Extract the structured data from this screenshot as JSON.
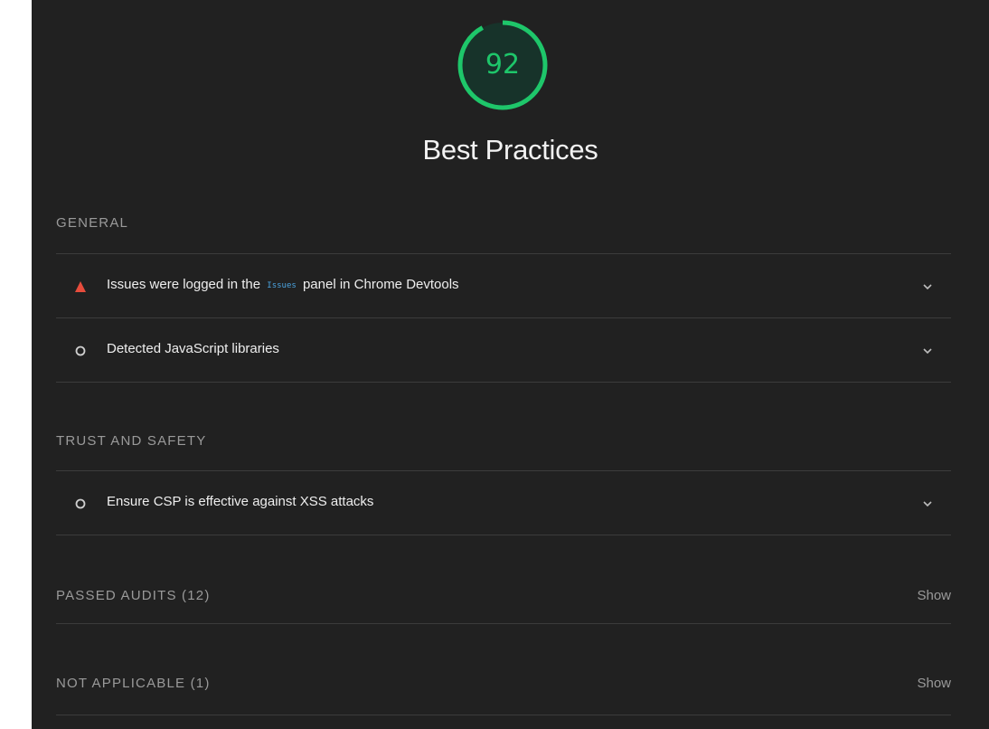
{
  "score": {
    "value": "92",
    "fraction": 0.92,
    "color": "#1ec66a"
  },
  "category": {
    "title": "Best Practices"
  },
  "groups": {
    "general": {
      "header": "GENERAL",
      "audits": [
        {
          "status": "fail",
          "status_icon": "red-triangle-icon",
          "title_before": "Issues were logged in the ",
          "title_code": "Issues",
          "title_after": " panel in Chrome Devtools"
        },
        {
          "status": "informative",
          "status_icon": "gray-circle-icon",
          "title": "Detected JavaScript libraries"
        }
      ]
    },
    "trust": {
      "header": "TRUST AND SAFETY",
      "audits": [
        {
          "status": "informative",
          "status_icon": "gray-circle-icon",
          "title": "Ensure CSP is effective against XSS attacks"
        }
      ]
    },
    "passed": {
      "header": "PASSED AUDITS (12)",
      "toggle": "Show"
    },
    "not_applicable": {
      "header": "NOT APPLICABLE (1)",
      "toggle": "Show"
    }
  },
  "colors": {
    "background": "#212121",
    "fail": "#e74c3c",
    "accent_link": "#4aa3df"
  }
}
